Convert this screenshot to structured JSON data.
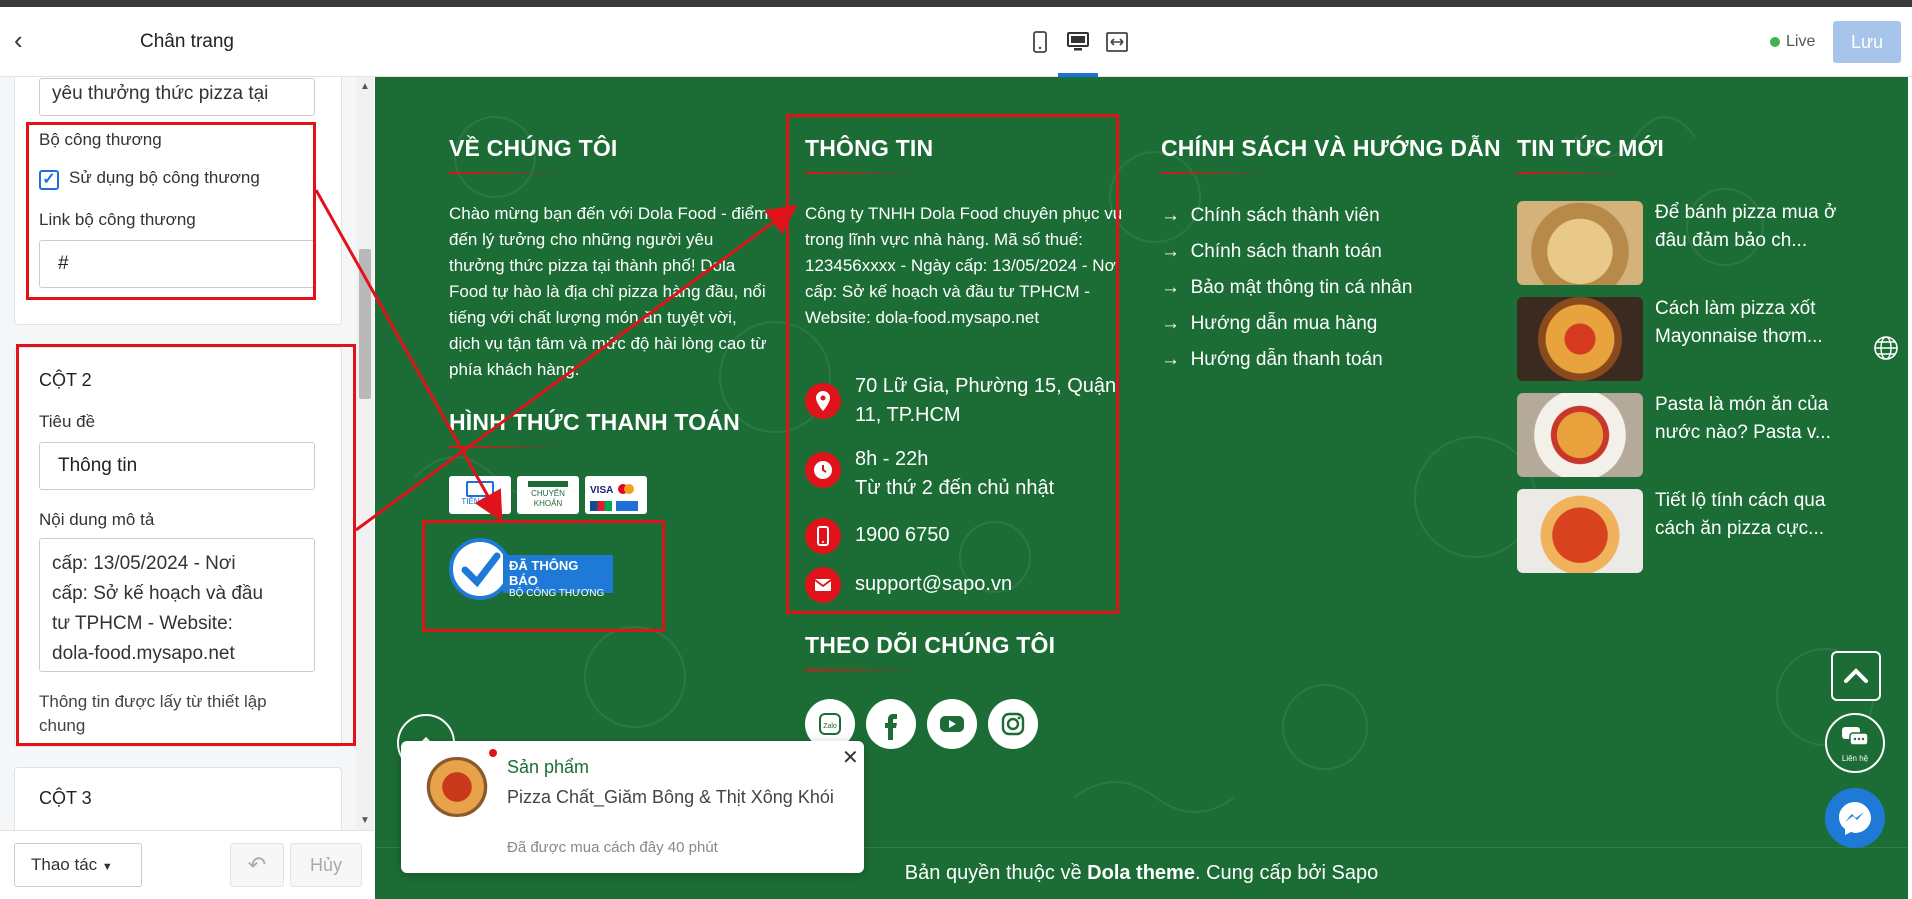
{
  "left_panel": {
    "title": "Chân trang",
    "prev_textarea_value": "yêu thưởng thức pizza tại",
    "bct_section_label": "Bộ công thương",
    "bct_checkbox_label": "Sử dụng bộ công thương",
    "bct_link_label": "Link bộ công thương",
    "bct_link_value": "#",
    "col2_heading": "CỘT 2",
    "col2_title_label": "Tiêu đề",
    "col2_title_value": "Thông tin",
    "col2_desc_label": "Nội dung mô tả",
    "col2_desc_lines": [
      "cấp: 13/05/2024 - Nơi",
      "cấp: Sở kế hoạch và đầu",
      "tư TPHCM - Website:",
      "dola-food.mysapo.net"
    ],
    "col2_note": "Thông tin được lấy từ thiết lập chung",
    "col3_heading": "CỘT 3",
    "actions_label": "Thao tác",
    "cancel_label": "Hủy"
  },
  "toolbar": {
    "live_label": "Live",
    "save_label": "Lưu"
  },
  "footer": {
    "about": {
      "title": "VỀ CHÚNG TÔI",
      "text": "Chào mừng bạn đến với Dola Food - điểm đến lý tưởng cho những người yêu thưởng thức pizza tại thành phố! Dola Food tự hào là địa chỉ pizza hàng đầu, nổi tiếng với chất lượng món ăn tuyệt vời, dịch vụ tận tâm và mức độ hài lòng cao từ phía khách hàng."
    },
    "payment": {
      "title": "HÌNH THỨC THANH TOÁN",
      "cards": [
        "TIỀN MẶT",
        "CHUYỂN KHOẢN",
        "VISA"
      ],
      "bct_badge_main": "ĐÃ THÔNG BÁO",
      "bct_badge_sub": "BỘ CÔNG THƯƠNG"
    },
    "info": {
      "title": "THÔNG TIN",
      "text": "Công ty TNHH Dola Food chuyên phục vụ trong lĩnh vực nhà hàng. Mã số thuế: 123456xxxx - Ngày cấp: 13/05/2024 - Nơi cấp: Sở kế hoạch và đầu tư TPHCM - Website: dola-food.mysapo.net",
      "address": "70 Lữ Gia, Phường 15, Quận 11, TP.HCM",
      "hours_1": "8h - 22h",
      "hours_2": "Từ thứ 2 đến chủ nhật",
      "phone": "1900 6750",
      "email": "support@sapo.vn"
    },
    "follow": {
      "title": "THEO DÕI CHÚNG TÔI"
    },
    "policy": {
      "title": "CHÍNH SÁCH VÀ HƯỚNG DẪN",
      "items": [
        "Chính sách thành viên",
        "Chính sách thanh toán",
        "Bảo mật thông tin cá nhân",
        "Hướng dẫn mua hàng",
        "Hướng dẫn thanh toán"
      ]
    },
    "news": {
      "title": "TIN TỨC MỚI",
      "items": [
        {
          "title": "Để bánh pizza mua ở đâu đảm bảo ch..."
        },
        {
          "title": "Cách làm pizza xốt Mayonnaise thơm..."
        },
        {
          "title": "Pasta là món ăn của nước nào? Pasta v..."
        },
        {
          "title": "Tiết lộ tính cách qua cách ăn pizza cực..."
        }
      ]
    },
    "copyright_prefix": "Bản quyền thuộc về ",
    "copyright_brand": "Dola theme",
    "copyright_suffix": ". Cung cấp bởi Sapo"
  },
  "toast": {
    "tag": "Sản phẩm",
    "product": "Pizza Chất_Giăm Bông & Thịt Xông Khói",
    "time": "Đã được mua cách đây 40 phút"
  },
  "contact_label": "Liên hệ",
  "colors": {
    "footer_green": "#1c6d35",
    "accent_red": "#e0131b",
    "save_blue": "#a7c5ea"
  }
}
